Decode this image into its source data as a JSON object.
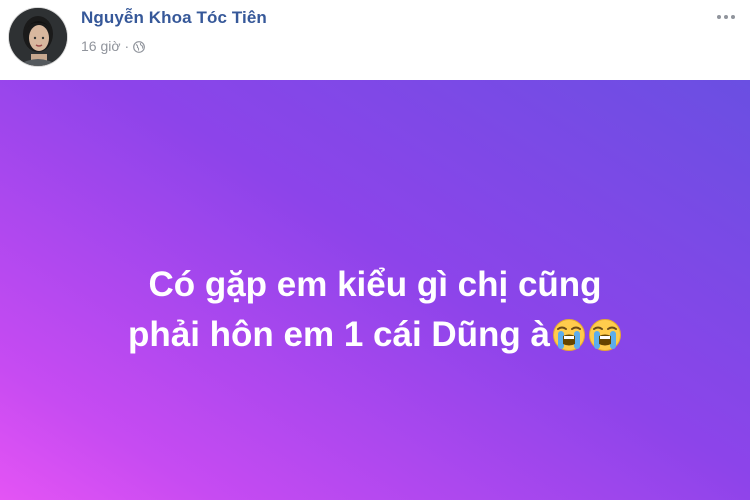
{
  "post": {
    "author": "Nguyễn Khoa Tóc Tiên",
    "time": "16 giờ",
    "separator": "·",
    "privacy_icon": "globe-icon",
    "more_icon": "more-options-icon",
    "avatar_icon": "avatar",
    "body_line_1": "Có gặp em kiểu gì chị cũng",
    "body_line_2": "phải hôn em 1 cái Dũng à",
    "emoji_count": 2,
    "emoji_icon": "loudly-crying-face-icon",
    "background_colors": [
      "#e454f4",
      "#c74bf2",
      "#8d44ea",
      "#6a4fe2"
    ],
    "author_color": "#365899",
    "meta_color": "#90949c"
  }
}
